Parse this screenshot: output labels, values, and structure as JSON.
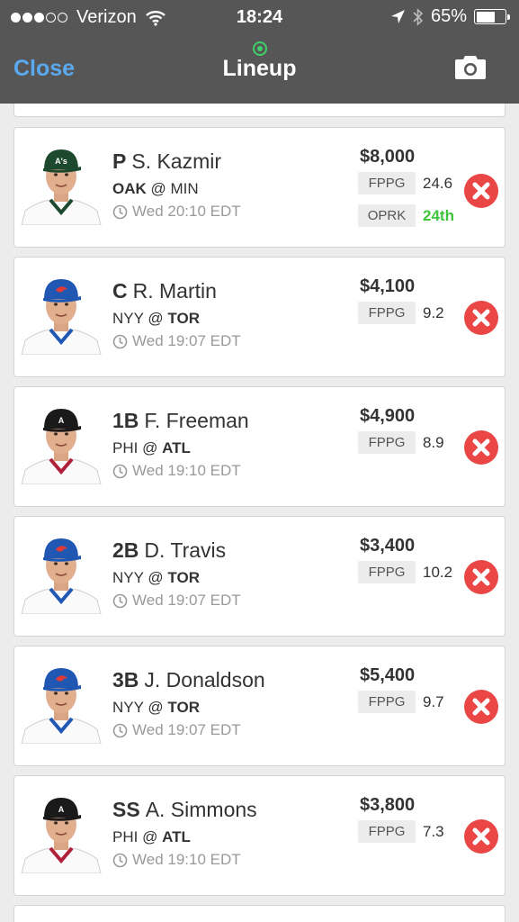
{
  "status_bar": {
    "carrier": "Verizon",
    "time": "18:24",
    "battery": "65%"
  },
  "nav": {
    "close_label": "Close",
    "title": "Lineup"
  },
  "players": [
    {
      "position": "P",
      "name": "S. Kazmir",
      "team": "OAK",
      "opponent": "MIN",
      "sep": "@",
      "bold_side": "team",
      "game_time": "Wed 20:10 EDT",
      "salary": "$8,000",
      "fppg_label": "FPPG",
      "fppg": "24.6",
      "oprk_label": "OPRK",
      "oprk": "24th",
      "cap": "#1d4a2e",
      "logo": "A's"
    },
    {
      "position": "C",
      "name": "R. Martin",
      "team": "NYY",
      "opponent": "TOR",
      "sep": "@",
      "bold_side": "opponent",
      "game_time": "Wed 19:07 EDT",
      "salary": "$4,100",
      "fppg_label": "FPPG",
      "fppg": "9.2",
      "cap": "#1f57b2",
      "logo": "bird"
    },
    {
      "position": "1B",
      "name": "F. Freeman",
      "team": "PHI",
      "opponent": "ATL",
      "sep": "@",
      "bold_side": "opponent",
      "game_time": "Wed 19:10 EDT",
      "salary": "$4,900",
      "fppg_label": "FPPG",
      "fppg": "8.9",
      "cap": "#1a1a1a",
      "logo": "A"
    },
    {
      "position": "2B",
      "name": "D. Travis",
      "team": "NYY",
      "opponent": "TOR",
      "sep": "@",
      "bold_side": "opponent",
      "game_time": "Wed 19:07 EDT",
      "salary": "$3,400",
      "fppg_label": "FPPG",
      "fppg": "10.2",
      "cap": "#1f57b2",
      "logo": "bird"
    },
    {
      "position": "3B",
      "name": "J. Donaldson",
      "team": "NYY",
      "opponent": "TOR",
      "sep": "@",
      "bold_side": "opponent",
      "game_time": "Wed 19:07 EDT",
      "salary": "$5,400",
      "fppg_label": "FPPG",
      "fppg": "9.7",
      "cap": "#1f57b2",
      "logo": "bird"
    },
    {
      "position": "SS",
      "name": "A. Simmons",
      "team": "PHI",
      "opponent": "ATL",
      "sep": "@",
      "bold_side": "opponent",
      "game_time": "Wed 19:10 EDT",
      "salary": "$3,800",
      "fppg_label": "FPPG",
      "fppg": "7.3",
      "cap": "#1a1a1a",
      "logo": "A"
    }
  ],
  "colors": {
    "nav_bg": "#565656",
    "close_blue": "#5aa9ee",
    "live_green": "#3ed16a",
    "remove_red": "#ea4646",
    "rank_green": "#3ec53a"
  },
  "icons": [
    "wifi-icon",
    "location-arrow-icon",
    "bluetooth-icon",
    "battery-icon",
    "live-indicator-icon",
    "camera-icon",
    "clock-icon",
    "remove-icon"
  ]
}
